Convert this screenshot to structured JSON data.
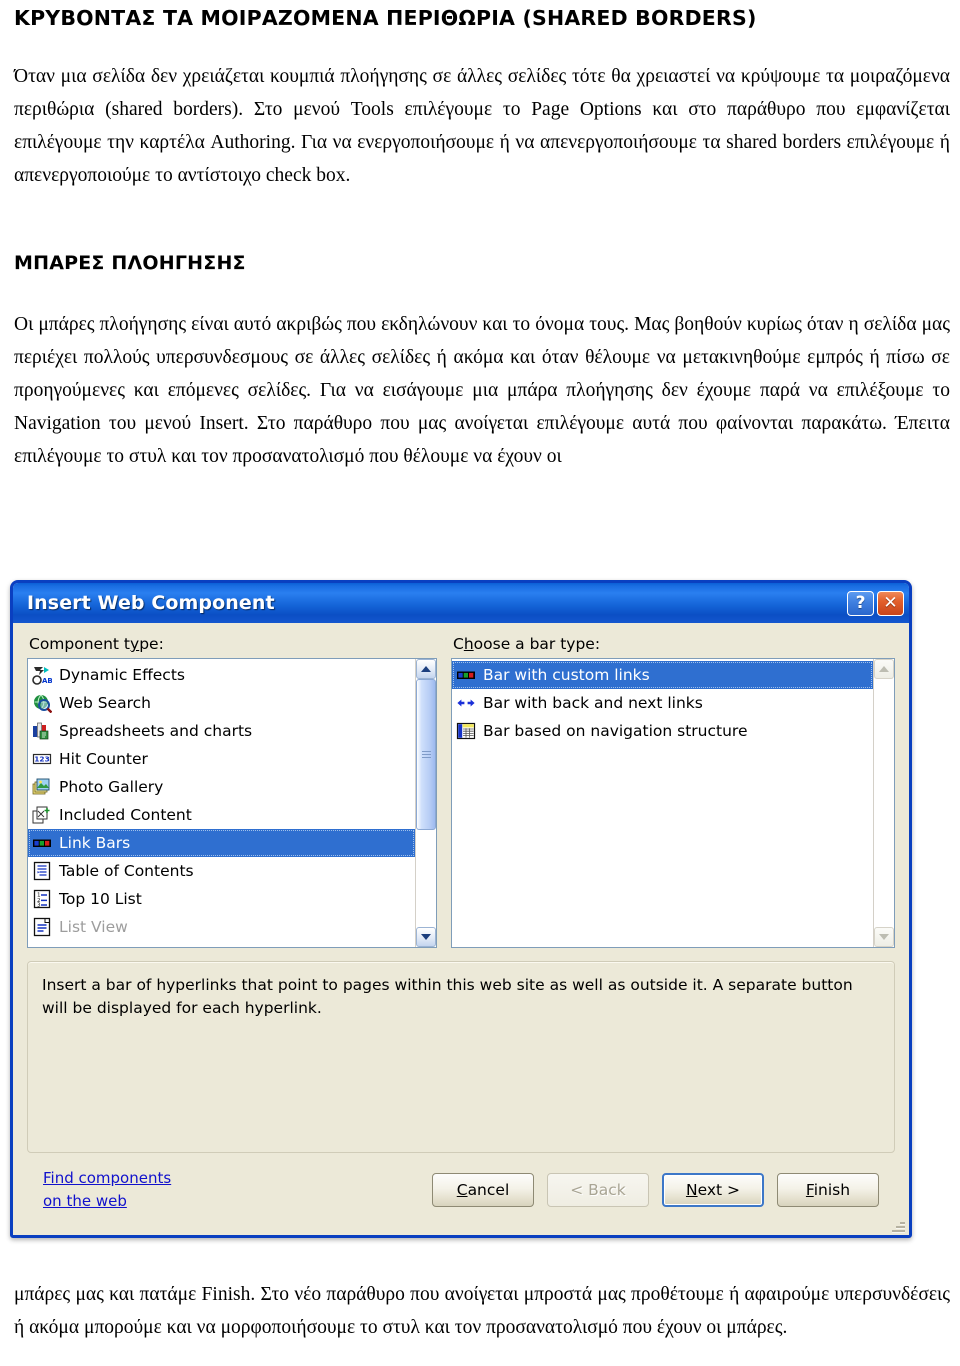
{
  "document": {
    "heading_main": "ΚΡΥΒΟΝΤΑΣ ΤΑ ΜΟΙΡΑΖΟΜΕΝΑ ΠΕΡΙΘΩΡΙΑ (SHARED BORDERS)",
    "paragraph_1": "Όταν μια σελίδα δεν χρειάζεται κουμπιά πλοήγησης σε άλλες σελίδες τότε θα χρειαστεί να κρύψουμε τα μοιραζόμενα περιθώρια (shared borders). Στο μενού Tools επιλέγουμε το Page Options και στο παράθυρο που εμφανίζεται επιλέγουμε την καρτέλα Authoring. Για να ενεργοποιήσουμε ή να απενεργοποιήσουμε τα shared borders επιλέγουμε ή απενεργοποιούμε το αντίστοιχο check box.",
    "heading_nav": "ΜΠΑΡΕΣ ΠΛΟΗΓΗΣΗΣ",
    "paragraph_2": "Οι μπάρες πλοήγησης είναι αυτό ακριβώς που εκδηλώνουν και το όνομα τους. Μας βοηθούν κυρίως όταν η σελίδα μας περιέχει πολλούς υπερσυνδεσμους σε άλλες σελίδες ή ακόμα και όταν θέλουμε να μετακινηθούμε εμπρός ή πίσω σε προηγούμενες και επόμενες σελίδες. Για να εισάγουμε μια μπάρα πλοήγησης δεν έχουμε παρά να επιλέξουμε το Navigation του μενού Insert. Στο παράθυρο που μας ανοίγεται επιλέγουμε αυτά που φαίνονται παρακάτω. Έπειτα επιλέγουμε το στυλ και τον προσανατολισμό που θέλουμε να έχουν οι",
    "paragraph_3": "μπάρες μας και πατάμε Finish. Στο νέο παράθυρο που ανοίγεται μπροστά μας προθέτουμε ή αφαιρούμε υπερσυνδέσεις ή ακόμα μπορούμε και να μορφοποιήσουμε το στυλ και τον προσανατολισμό που έχουν οι μπάρες."
  },
  "dialog": {
    "title": "Insert Web Component",
    "titlebar_color": "#0a5fd6",
    "help_button": "?",
    "close_button": "✕",
    "component_type_label": "Component type:",
    "bar_type_label": "Choose a bar type:",
    "component_types": [
      {
        "label": "Dynamic Effects",
        "icon": "dynamic-effects-icon",
        "selected": false,
        "disabled": false
      },
      {
        "label": "Web Search",
        "icon": "web-search-icon",
        "selected": false,
        "disabled": false
      },
      {
        "label": "Spreadsheets and charts",
        "icon": "spreadsheets-charts-icon",
        "selected": false,
        "disabled": false
      },
      {
        "label": "Hit Counter",
        "icon": "hit-counter-icon",
        "selected": false,
        "disabled": false
      },
      {
        "label": "Photo Gallery",
        "icon": "photo-gallery-icon",
        "selected": false,
        "disabled": false
      },
      {
        "label": "Included Content",
        "icon": "included-content-icon",
        "selected": false,
        "disabled": false
      },
      {
        "label": "Link Bars",
        "icon": "link-bars-icon",
        "selected": true,
        "disabled": false
      },
      {
        "label": "Table of Contents",
        "icon": "table-of-contents-icon",
        "selected": false,
        "disabled": false
      },
      {
        "label": "Top 10 List",
        "icon": "top-10-list-icon",
        "selected": false,
        "disabled": false
      },
      {
        "label": "List View",
        "icon": "list-view-icon",
        "selected": false,
        "disabled": true
      }
    ],
    "bar_types": [
      {
        "label": "Bar with custom links",
        "icon": "custom-links-icon",
        "selected": true
      },
      {
        "label": "Bar with back and next links",
        "icon": "back-next-arrows-icon",
        "selected": false
      },
      {
        "label": "Bar based on navigation structure",
        "icon": "navigation-structure-icon",
        "selected": false
      }
    ],
    "description": "Insert a bar of hyperlinks that point to pages within this web site as well as outside it.  A separate button will be displayed for each hyperlink.",
    "find_components_line1": "Find components",
    "find_components_line2": "on the web",
    "buttons": {
      "cancel": "Cancel",
      "back": "< Back",
      "next": "Next >",
      "finish": "Finish"
    },
    "selection_color": "#2f6fd0",
    "face_color": "#ece9d8"
  }
}
